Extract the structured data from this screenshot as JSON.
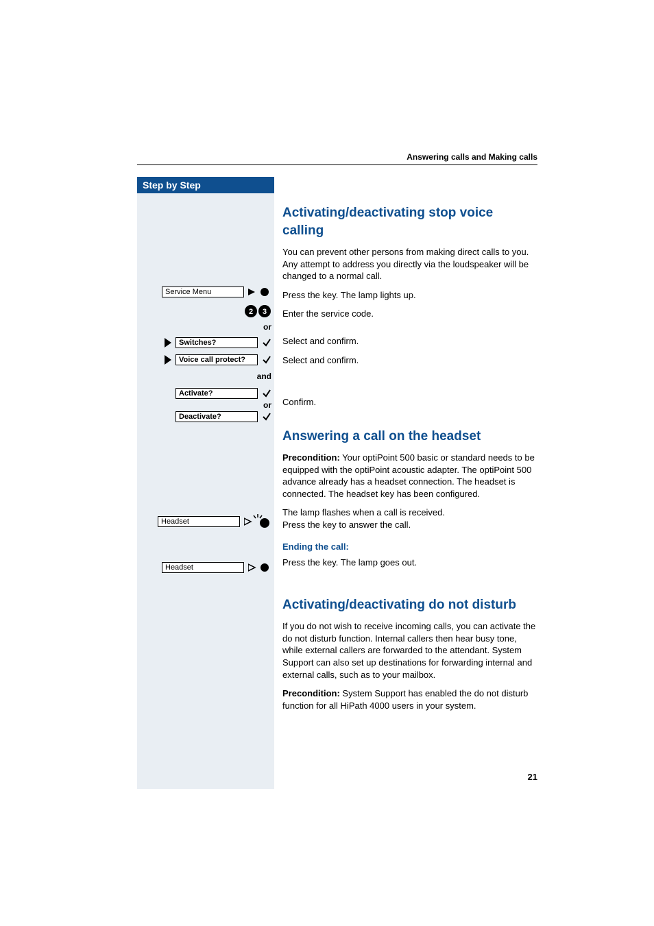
{
  "running_header": "Answering calls and Making calls",
  "sidebar": {
    "header": "Step by Step",
    "rows": {
      "service_menu": "Service Menu",
      "or1": "or",
      "switches": "Switches?",
      "voice_protect": "Voice call protect?",
      "and1": "and",
      "activate": "Activate?",
      "or2": "or",
      "deactivate": "Deactivate?",
      "headset1": "Headset",
      "headset2": "Headset"
    }
  },
  "main": {
    "s1": {
      "title": "Activating/deactivating stop voice calling",
      "p1": "You can prevent other persons from making direct calls to you. Any attempt to address you directly via the loudspeaker will be changed to a normal call.",
      "p2": "Press the key. The lamp lights up.",
      "p3": "Enter the service code.",
      "p4": "Select and confirm.",
      "p5": "Select and confirm.",
      "p6": "Confirm."
    },
    "s2": {
      "title": "Answering a call on the headset",
      "precond_label": "Precondition:",
      "precond_text": " Your optiPoint 500 basic or standard needs to be equipped with the optiPoint acoustic adapter. The optiPoint 500 advance already has a headset connection. The headset is connected. The headset key has been configured.",
      "p1a": "The lamp flashes when a call is received.",
      "p1b": "Press the key to answer the call.",
      "sub": "Ending the call:",
      "p2": "Press the key. The lamp goes out."
    },
    "s3": {
      "title": "Activating/deactivating do not disturb",
      "p1": "If you do not wish to receive incoming calls, you can activate the do not disturb function. Internal callers then hear busy tone, while external callers are forwarded to the attendant. System Support can also set up destinations for forwarding internal and external calls, such as to your mailbox.",
      "precond_label": "Precondition:",
      "precond_text": " System Support has enabled the do not disturb function for all HiPath 4000 users in your system."
    }
  },
  "page_number": "21"
}
